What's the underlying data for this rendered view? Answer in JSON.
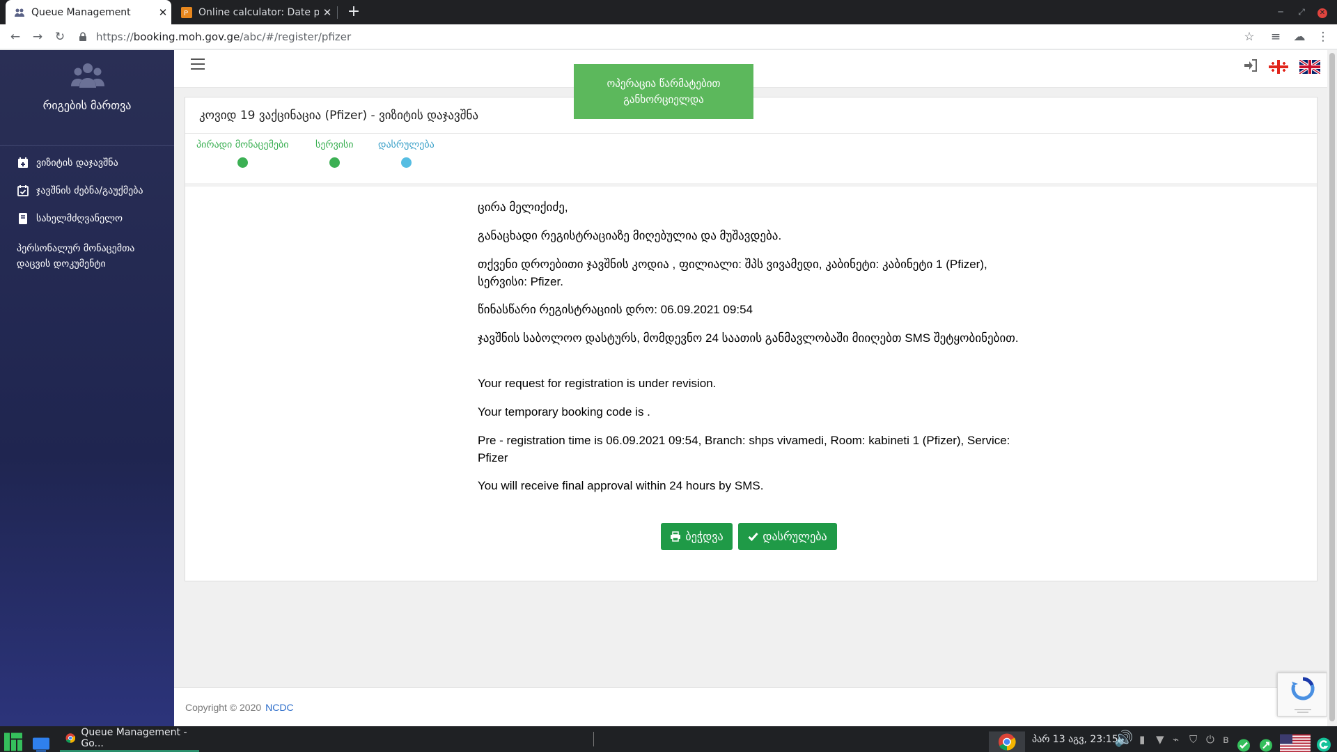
{
  "browser": {
    "tabs": [
      {
        "title": "Queue Management",
        "active": true
      },
      {
        "title": "Online calculator: Date plus d",
        "active": false
      }
    ],
    "url_host": "booking.moh.gov.ge",
    "url_rest": "/abc/#/register/pfizer",
    "url_scheme": "https://"
  },
  "sidebar": {
    "title": "რიგების მართვა",
    "items": [
      {
        "label": "ვიზიტის დაჯავშნა",
        "icon": "calendar-plus-icon"
      },
      {
        "label": "ჯავშნის ძებნა/გაუქმება",
        "icon": "calendar-check-icon"
      },
      {
        "label": "სახელმძღვანელო",
        "icon": "book-icon"
      }
    ],
    "doc_link": "პერსონალურ მონაცემთა დაცვის დოკუმენტი"
  },
  "toast": {
    "text": "ოპერაცია წარმატებით განხორციელდა"
  },
  "card": {
    "title": "კოვიდ 19 ვაქცინაცია (Pfizer) - ვიზიტის დაჯავშნა",
    "steps": [
      {
        "label": "პირადი მონაცემები",
        "state": "done"
      },
      {
        "label": "სერვისი",
        "state": "done"
      },
      {
        "label": "დასრულება",
        "state": "current"
      }
    ],
    "messages": [
      "ცირა მელიქიძე,",
      "განაცხადი რეგისტრაციაზე მიღებულია და მუშავდება.",
      "თქვენი დროებითი ჯავშნის კოდია , ფილიალი: შპს ვივამედი, კაბინეტი: კაბინეტი 1 (Pfizer), სერვისი: Pfizer.",
      "წინასწარი რეგისტრაციის დრო: 06.09.2021 09:54",
      "ჯავშნის საბოლოო დასტურს, მომდევნო 24 საათის განმავლობაში მიიღებთ SMS შეტყობინებით.",
      "Your request for registration is under revision.",
      "Your temporary booking code is .",
      "Pre - registration time is 06.09.2021 09:54, Branch: shps vivamedi, Room: kabineti 1 (Pfizer), Service: Pfizer",
      "You will receive final approval within 24 hours by SMS."
    ],
    "print_label": "ბეჭდვა",
    "finish_label": "დასრულება"
  },
  "footer": {
    "copyright": "Copyright © 2020",
    "link": "NCDC"
  },
  "taskbar": {
    "app_label": "Queue Management - Go...",
    "clock": "პარ 13 აგვ, 23:15"
  },
  "colors": {
    "accent_green": "#1f9a47",
    "toast_green": "#5cb85c",
    "sidebar_navy": "#1f2550",
    "step_current": "#56bde2"
  }
}
